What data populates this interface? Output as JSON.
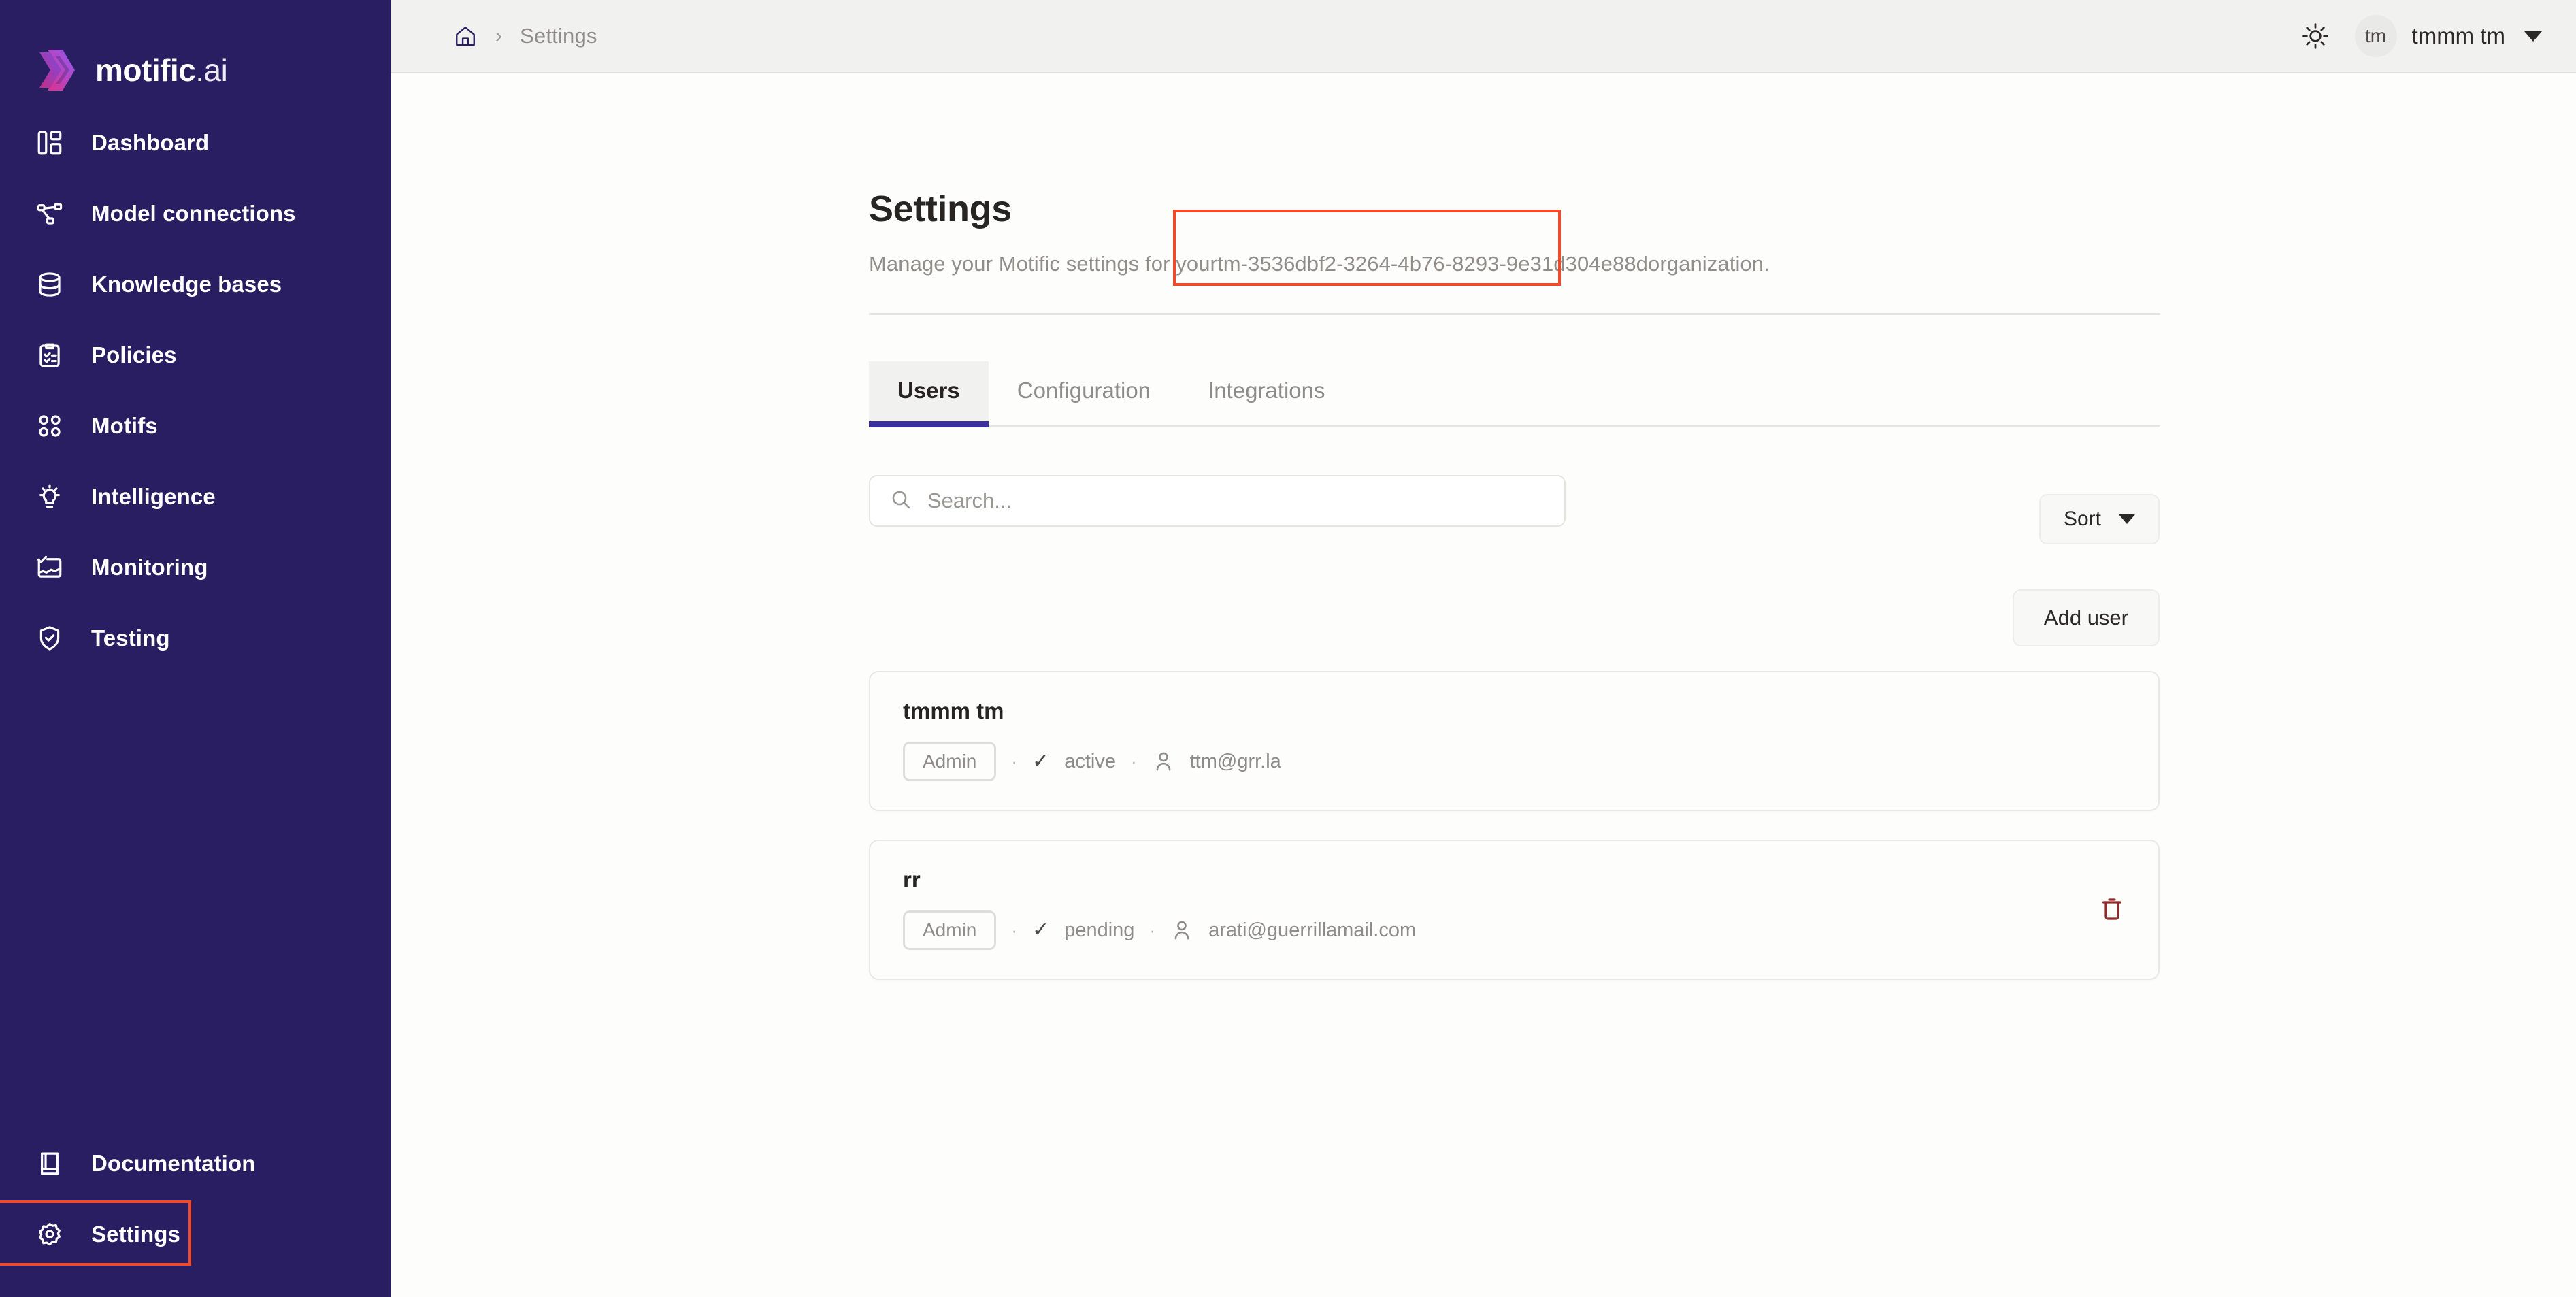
{
  "brand": {
    "name": "motific",
    "suffix": ".ai",
    "logo_icon": "motific-hexagon-logo"
  },
  "sidebar": {
    "items": [
      {
        "label": "Dashboard",
        "icon": "layout-dashboard-icon"
      },
      {
        "label": "Model connections",
        "icon": "network-nodes-icon"
      },
      {
        "label": "Knowledge bases",
        "icon": "database-icon"
      },
      {
        "label": "Policies",
        "icon": "clipboard-check-icon"
      },
      {
        "label": "Motifs",
        "icon": "four-circles-icon"
      },
      {
        "label": "Intelligence",
        "icon": "lightbulb-icon"
      },
      {
        "label": "Monitoring",
        "icon": "monitoring-chart-icon"
      },
      {
        "label": "Testing",
        "icon": "shield-check-icon"
      }
    ],
    "bottom_items": [
      {
        "label": "Documentation",
        "icon": "book-icon",
        "highlighted": false
      },
      {
        "label": "Settings",
        "icon": "gear-icon",
        "highlighted": true
      }
    ]
  },
  "topbar": {
    "home_icon": "home-icon",
    "separator": "›",
    "breadcrumb_current": "Settings",
    "theme_toggle_icon": "sun-icon",
    "avatar_initials": "tm",
    "user_name": "tmmm tm",
    "user_menu_icon": "chevron-down-icon"
  },
  "page": {
    "title": "Settings",
    "subtitle_prefix": "Manage your Motific settings for your ",
    "org_id": "tm-3536dbf2-3264-4b76-8293-9e31d304e88d",
    "subtitle_suffix": " organization."
  },
  "tabs": [
    {
      "label": "Users",
      "active": true
    },
    {
      "label": "Configuration",
      "active": false
    },
    {
      "label": "Integrations",
      "active": false
    }
  ],
  "toolbar": {
    "search_placeholder": "Search...",
    "search_value": "",
    "search_icon": "search-icon",
    "sort_label": "Sort",
    "sort_caret_icon": "caret-down-icon",
    "add_user_label": "Add user"
  },
  "users": [
    {
      "name": "tmmm tm",
      "role": "Admin",
      "status": "active",
      "status_icon": "check-icon",
      "email": "ttm@grr.la",
      "email_icon": "person-icon",
      "has_delete": false,
      "delete_icon": "trash-icon"
    },
    {
      "name": "rr",
      "role": "Admin",
      "status": "pending",
      "status_icon": "check-icon",
      "email": "arati@guerrillamail.com",
      "email_icon": "person-icon",
      "has_delete": true,
      "delete_icon": "trash-icon"
    }
  ],
  "colors": {
    "sidebar_bg": "#2A1E63",
    "accent_purple": "#3B2E9E",
    "highlight_red": "#F04A2A",
    "content_bg": "#FDFDFB",
    "topbar_bg": "#F1F1F0",
    "trash_red": "#8F2B2B"
  },
  "annotations": [
    {
      "name": "org-id-highlight",
      "target": "org_id"
    },
    {
      "name": "settings-nav-highlight",
      "target": "sidebar.bottom_items.1"
    }
  ]
}
